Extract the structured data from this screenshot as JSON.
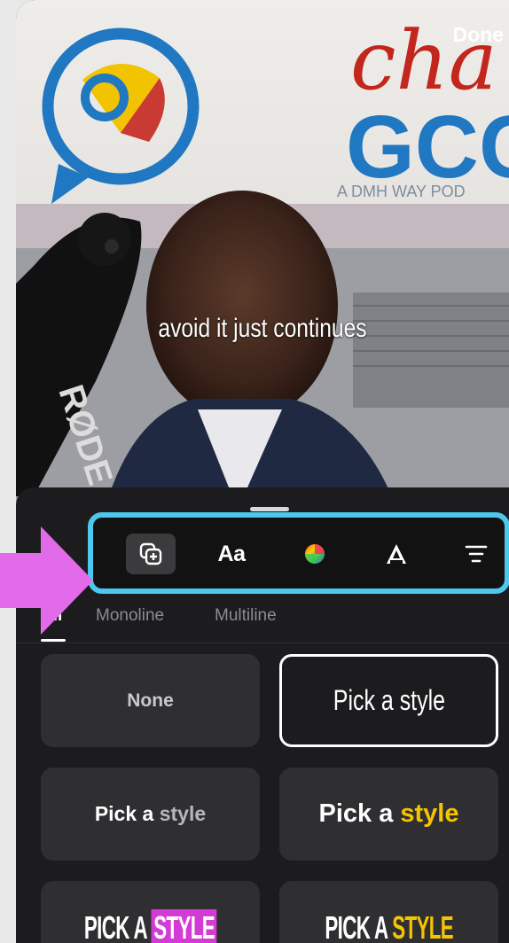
{
  "header": {
    "done_label": "Done"
  },
  "video": {
    "caption": "avoid it just continues",
    "sign": {
      "line1": "cha",
      "line2": "GCC",
      "line3": "A DMH WAY POD"
    },
    "mic_brand": "RØDE"
  },
  "toolbar": {
    "items": [
      {
        "icon": "add-overlay-icon",
        "selected": true
      },
      {
        "label": "Aa",
        "icon": "font-icon"
      },
      {
        "icon": "color-wheel-icon"
      },
      {
        "icon": "text-style-icon"
      },
      {
        "icon": "align-icon"
      }
    ]
  },
  "tabs": [
    "All",
    "Monoline",
    "Multiline"
  ],
  "active_tab": "All",
  "styles": {
    "none": "None",
    "condensed": "Pick a style",
    "mixed": {
      "first": "Pick a",
      "second": "style"
    },
    "bold": {
      "first": "Pick a",
      "second": "style"
    },
    "caps_highlight": {
      "first": "PICK A",
      "second": "STYLE"
    },
    "caps_yellow": {
      "first": "PICK A",
      "second": "STYLE"
    }
  },
  "colors": {
    "accent_border": "#4ec7ee",
    "arrow": "#e16be9",
    "highlight_magenta": "#d43ad6",
    "highlight_yellow": "#f6c500"
  }
}
